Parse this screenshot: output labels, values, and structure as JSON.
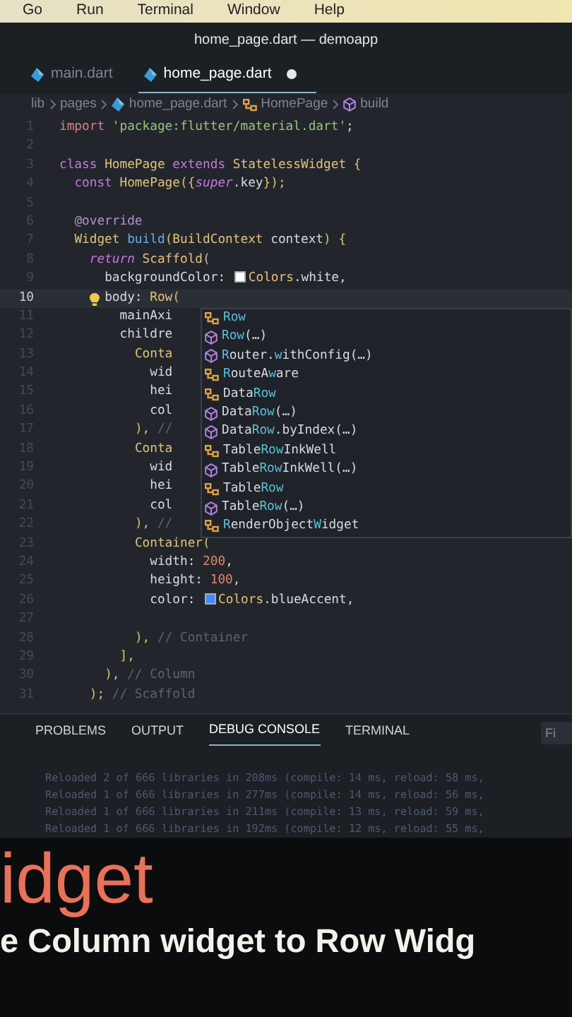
{
  "menu_bar": {
    "items": [
      "Go",
      "Run",
      "Terminal",
      "Window",
      "Help"
    ]
  },
  "window": {
    "title": "home_page.dart — demoapp"
  },
  "tabs": [
    {
      "label": "main.dart",
      "selected": false,
      "dirty": false
    },
    {
      "label": "home_page.dart",
      "selected": true,
      "dirty": true
    }
  ],
  "breadcrumb": [
    {
      "label": "lib"
    },
    {
      "label": "pages"
    },
    {
      "label": "home_page.dart",
      "kind": "dart"
    },
    {
      "label": "HomePage",
      "kind": "class"
    },
    {
      "label": "build",
      "kind": "method"
    }
  ],
  "editor": {
    "lines": [
      {
        "number": "1",
        "current": false,
        "tokens": [
          {
            "kind": "imp",
            "t": "import "
          },
          {
            "kind": "str",
            "t": "'package:flutter/material.dart'"
          },
          {
            "kind": "plain",
            "t": ";"
          }
        ]
      },
      {
        "number": "2",
        "current": false
      },
      {
        "number": "3",
        "current": false,
        "tokens": [
          {
            "kind": "kw",
            "t": "class "
          },
          {
            "kind": "type",
            "t": "HomePage "
          },
          {
            "kind": "kw",
            "t": "extends "
          },
          {
            "kind": "type",
            "t": "StatelessWidget "
          },
          {
            "kind": "brace",
            "t": "{"
          }
        ]
      },
      {
        "number": "4",
        "current": false,
        "tokens": [
          {
            "kind": "kw",
            "t": "  const "
          },
          {
            "kind": "type",
            "t": "HomePage"
          },
          {
            "kind": "brace",
            "t": "({"
          },
          {
            "kind": "kwi",
            "t": "super"
          },
          {
            "kind": "plain",
            "t": ".key"
          },
          {
            "kind": "brace",
            "t": "});"
          }
        ]
      },
      {
        "number": "5",
        "current": false
      },
      {
        "number": "6",
        "current": false,
        "tokens": [
          {
            "kind": "meta",
            "t": "  @override"
          }
        ]
      },
      {
        "number": "7",
        "current": false,
        "tokens": [
          {
            "kind": "type",
            "t": "  Widget "
          },
          {
            "kind": "fn",
            "t": "build"
          },
          {
            "kind": "brace",
            "t": "("
          },
          {
            "kind": "type",
            "t": "BuildContext "
          },
          {
            "kind": "plain",
            "t": "context"
          },
          {
            "kind": "brace",
            "t": ") {"
          }
        ]
      },
      {
        "number": "8",
        "current": false,
        "tokens": [
          {
            "kind": "kwi",
            "t": "    return "
          },
          {
            "kind": "type",
            "t": "Scaffold"
          },
          {
            "kind": "brace",
            "t": "("
          }
        ]
      },
      {
        "number": "9",
        "current": false,
        "tokens": [
          {
            "kind": "plain",
            "t": "      backgroundColor: "
          },
          {
            "kind": "swatch",
            "color": "#ffffff"
          },
          {
            "kind": "type",
            "t": "Colors"
          },
          {
            "kind": "plain",
            "t": ".white,"
          }
        ]
      },
      {
        "number": "10",
        "current": true,
        "tokens": [
          {
            "kind": "plain",
            "t": "      body: "
          },
          {
            "kind": "type",
            "t": "Row"
          },
          {
            "kind": "brace",
            "t": "("
          }
        ]
      },
      {
        "number": "11",
        "current": false,
        "tokens": [
          {
            "kind": "plain",
            "t": "        mainAxi"
          }
        ]
      },
      {
        "number": "12",
        "current": false,
        "tokens": [
          {
            "kind": "plain",
            "t": "        childre"
          }
        ]
      },
      {
        "number": "13",
        "current": false,
        "tokens": [
          {
            "kind": "type",
            "t": "          Conta"
          }
        ]
      },
      {
        "number": "14",
        "current": false,
        "tokens": [
          {
            "kind": "plain",
            "t": "            wid"
          }
        ]
      },
      {
        "number": "15",
        "current": false,
        "tokens": [
          {
            "kind": "plain",
            "t": "            hei"
          }
        ]
      },
      {
        "number": "16",
        "current": false,
        "tokens": [
          {
            "kind": "plain",
            "t": "            col"
          }
        ]
      },
      {
        "number": "17",
        "current": false,
        "tokens": [
          {
            "kind": "brace",
            "t": "          ), "
          },
          {
            "kind": "comment",
            "t": "//"
          }
        ]
      },
      {
        "number": "18",
        "current": false,
        "tokens": [
          {
            "kind": "type",
            "t": "          Conta"
          }
        ]
      },
      {
        "number": "19",
        "current": false,
        "tokens": [
          {
            "kind": "plain",
            "t": "            wid"
          }
        ]
      },
      {
        "number": "20",
        "current": false,
        "tokens": [
          {
            "kind": "plain",
            "t": "            hei"
          }
        ]
      },
      {
        "number": "21",
        "current": false,
        "tokens": [
          {
            "kind": "plain",
            "t": "            col"
          }
        ]
      },
      {
        "number": "22",
        "current": false,
        "tokens": [
          {
            "kind": "brace",
            "t": "          ), "
          },
          {
            "kind": "comment",
            "t": "//"
          }
        ]
      },
      {
        "number": "23",
        "current": false,
        "tokens": [
          {
            "kind": "type",
            "t": "          Container"
          },
          {
            "kind": "brace",
            "t": "("
          }
        ]
      },
      {
        "number": "24",
        "current": false,
        "tokens": [
          {
            "kind": "plain",
            "t": "            width: "
          },
          {
            "kind": "num",
            "t": "200"
          },
          {
            "kind": "plain",
            "t": ","
          }
        ]
      },
      {
        "number": "25",
        "current": false,
        "tokens": [
          {
            "kind": "plain",
            "t": "            height: "
          },
          {
            "kind": "num",
            "t": "100"
          },
          {
            "kind": "plain",
            "t": ","
          }
        ]
      },
      {
        "number": "26",
        "current": false,
        "tokens": [
          {
            "kind": "plain",
            "t": "            color: "
          },
          {
            "kind": "swatch",
            "color": "#448aff"
          },
          {
            "kind": "type",
            "t": "Colors"
          },
          {
            "kind": "plain",
            "t": ".blueAccent,"
          }
        ]
      },
      {
        "number": "27",
        "current": false
      },
      {
        "number": "28",
        "current": false,
        "tokens": [
          {
            "kind": "brace",
            "t": "          ), "
          },
          {
            "kind": "comment",
            "t": "// Container"
          }
        ]
      },
      {
        "number": "29",
        "current": false,
        "tokens": [
          {
            "kind": "brace",
            "t": "        ],"
          }
        ]
      },
      {
        "number": "30",
        "current": false,
        "tokens": [
          {
            "kind": "brace",
            "t": "      ), "
          },
          {
            "kind": "comment",
            "t": "// Column"
          }
        ]
      },
      {
        "number": "31",
        "current": false,
        "tokens": [
          {
            "kind": "brace",
            "t": "    ); "
          },
          {
            "kind": "comment",
            "t": "// Scaffold"
          }
        ]
      }
    ]
  },
  "suggestions": [
    {
      "kind": "class",
      "parts": [
        {
          "t": "Row",
          "hit": true
        }
      ]
    },
    {
      "kind": "constructor",
      "parts": [
        {
          "t": "Row",
          "hit": true
        },
        {
          "t": "(…)",
          "hit": false
        }
      ]
    },
    {
      "kind": "constructor",
      "parts": [
        {
          "t": "R",
          "hit": true
        },
        {
          "t": "outer.",
          "hit": false
        },
        {
          "t": "w",
          "hit": true
        },
        {
          "t": "ithConfig(…)",
          "hit": false
        }
      ]
    },
    {
      "kind": "class",
      "parts": [
        {
          "t": "R",
          "hit": true
        },
        {
          "t": "outeA",
          "hit": false
        },
        {
          "t": "w",
          "hit": true
        },
        {
          "t": "are",
          "hit": false
        }
      ]
    },
    {
      "kind": "class",
      "parts": [
        {
          "t": "Data",
          "hit": false
        },
        {
          "t": "Row",
          "hit": true
        }
      ]
    },
    {
      "kind": "constructor",
      "parts": [
        {
          "t": "Data",
          "hit": false
        },
        {
          "t": "Row",
          "hit": true
        },
        {
          "t": "(…)",
          "hit": false
        }
      ]
    },
    {
      "kind": "constructor",
      "parts": [
        {
          "t": "Data",
          "hit": false
        },
        {
          "t": "Row",
          "hit": true
        },
        {
          "t": ".byIndex(…)",
          "hit": false
        }
      ]
    },
    {
      "kind": "class",
      "parts": [
        {
          "t": "Table",
          "hit": false
        },
        {
          "t": "Row",
          "hit": true
        },
        {
          "t": "InkWell",
          "hit": false
        }
      ]
    },
    {
      "kind": "constructor",
      "parts": [
        {
          "t": "Table",
          "hit": false
        },
        {
          "t": "Row",
          "hit": true
        },
        {
          "t": "InkWell(…)",
          "hit": false
        }
      ]
    },
    {
      "kind": "class",
      "parts": [
        {
          "t": "Table",
          "hit": false
        },
        {
          "t": "Row",
          "hit": true
        }
      ]
    },
    {
      "kind": "constructor",
      "parts": [
        {
          "t": "Table",
          "hit": false
        },
        {
          "t": "Row",
          "hit": true
        },
        {
          "t": "(…)",
          "hit": false
        }
      ]
    },
    {
      "kind": "class",
      "parts": [
        {
          "t": "R",
          "hit": true
        },
        {
          "t": "enderObject",
          "hit": false
        },
        {
          "t": "W",
          "hit": true
        },
        {
          "t": "idget",
          "hit": false
        }
      ]
    }
  ],
  "panel": {
    "tabs": [
      {
        "label": "PROBLEMS",
        "selected": false
      },
      {
        "label": "OUTPUT",
        "selected": false
      },
      {
        "label": "DEBUG CONSOLE",
        "selected": true
      },
      {
        "label": "TERMINAL",
        "selected": false
      }
    ],
    "filter_placeholder": "Fi",
    "console": [
      "Reloaded 2 of 666 libraries in 208ms (compile: 14 ms, reload: 58 ms,",
      "Reloaded 1 of 666 libraries in 277ms (compile: 14 ms, reload: 56 ms,",
      "Reloaded 1 of 666 libraries in 211ms (compile: 13 ms, reload: 59 ms,",
      "Reloaded 1 of 666 libraries in 192ms (compile: 12 ms, reload: 55 ms,"
    ]
  },
  "caption": {
    "heading": "idget",
    "subtitle": "e Column widget to Row Widg"
  }
}
